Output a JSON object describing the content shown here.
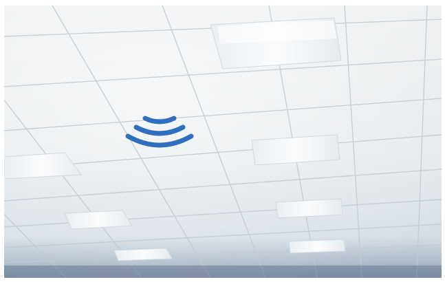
{
  "photo": {
    "subject": "ceiling",
    "colors": {
      "tile": "#e9ecee",
      "tile_shadow": "#c9d0d6",
      "grid_line": "#c3cad1",
      "light_panel": "#f8fafb",
      "floor_band": "#7d8ea3"
    }
  },
  "overlay_icon": {
    "name": "wireless-signal-icon",
    "color": "#2f6fbd"
  }
}
